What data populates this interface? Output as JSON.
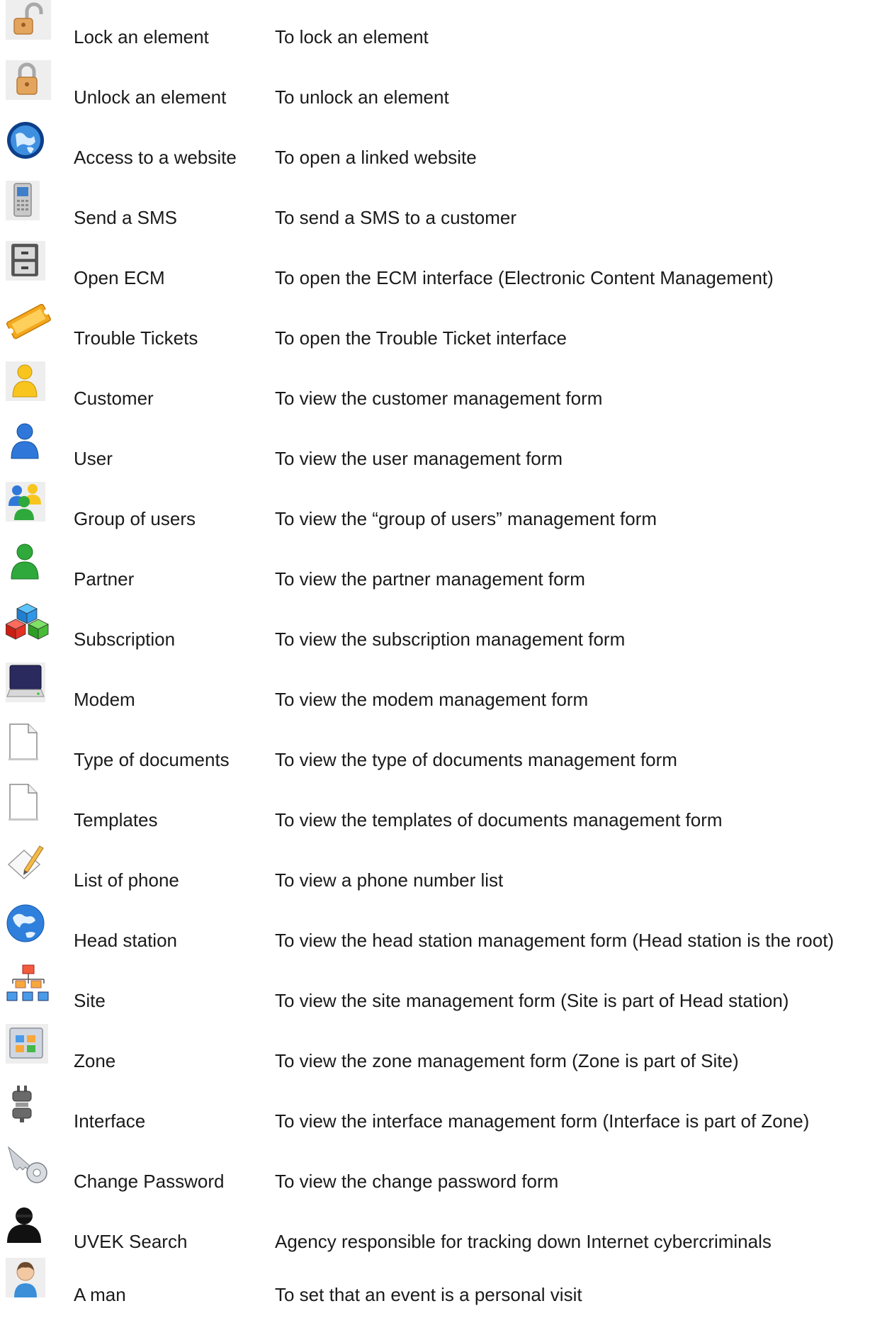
{
  "rows": [
    {
      "icon": "padlock-open-icon",
      "name": "Lock an element",
      "desc": "To lock an element"
    },
    {
      "icon": "padlock-closed-icon",
      "name": "Unlock an element",
      "desc": "To unlock an element"
    },
    {
      "icon": "globe-icon",
      "name": "Access to a website",
      "desc": "To open a linked website"
    },
    {
      "icon": "mobile-phone-icon",
      "name": "Send a SMS",
      "desc": "To send a SMS to a customer"
    },
    {
      "icon": "filing-cabinet-icon",
      "name": "Open ECM",
      "desc": "To open the ECM interface (Electronic Content Management)"
    },
    {
      "icon": "ticket-icon",
      "name": "Trouble Tickets",
      "desc": "To open the Trouble Ticket interface"
    },
    {
      "icon": "user-yellow-icon",
      "name": "Customer",
      "desc": "To view the customer management form"
    },
    {
      "icon": "user-blue-icon",
      "name": "User",
      "desc": "To view the user management form"
    },
    {
      "icon": "user-group-icon",
      "name": "Group of users",
      "desc": "To view the “group of users” management form"
    },
    {
      "icon": "user-green-icon",
      "name": "Partner",
      "desc": "To view the partner management form"
    },
    {
      "icon": "cubes-icon",
      "name": "Subscription",
      "desc": "To view the subscription management form"
    },
    {
      "icon": "modem-drive-icon",
      "name": "Modem",
      "desc": "To view the modem management form"
    },
    {
      "icon": "blank-document-icon",
      "name": "Type of documents",
      "desc": "To view the type of documents management form"
    },
    {
      "icon": "blank-document-icon",
      "name": "Templates",
      "desc": "To view the templates of documents management form"
    },
    {
      "icon": "edit-pencil-icon",
      "name": "List of phone",
      "desc": "To view a phone number list"
    },
    {
      "icon": "earth-icon",
      "name": "Head station",
      "desc": "To view the head station management form (Head station is the root)"
    },
    {
      "icon": "hierarchy-icon",
      "name": "Site",
      "desc": "To view the site management form (Site is part of Head station)"
    },
    {
      "icon": "zone-window-icon",
      "name": "Zone",
      "desc": "To view the zone management form (Zone is part of Site)"
    },
    {
      "icon": "plug-icon",
      "name": "Interface",
      "desc": "To view the interface management form (Interface is part of Zone)"
    },
    {
      "icon": "key-icon",
      "name": "Change Password",
      "desc": "To view the change password form"
    },
    {
      "icon": "silhouette-icon",
      "name": "UVEK Search",
      "desc": "Agency responsible for tracking down Internet cybercriminals"
    },
    {
      "icon": "man-avatar-icon",
      "name": "A man",
      "desc": "To set that an event is a personal visit"
    }
  ]
}
